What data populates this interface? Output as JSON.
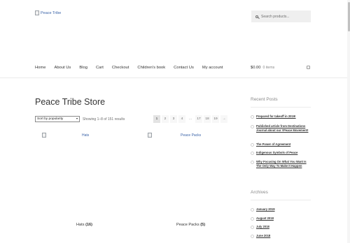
{
  "header": {
    "logo_alt": "Peace Tribe",
    "search_placeholder": "Search products..."
  },
  "nav": {
    "items": [
      "Home",
      "About Us",
      "Blog",
      "Cart",
      "Checkout",
      "Children's book",
      "Contact Us",
      "My account"
    ]
  },
  "cart": {
    "amount": "$0.00",
    "count": "0 items"
  },
  "main": {
    "title": "Peace Tribe Store",
    "sort_selected": "Sort by popularity",
    "showing": "Showing 1–8 of 151 results",
    "pages": [
      "1",
      "2",
      "3",
      "4",
      "…",
      "17",
      "18",
      "19"
    ],
    "current_page": "1",
    "products": [
      {
        "image_alt": "Hats",
        "name": "Hats",
        "count": "(16)"
      },
      {
        "image_alt": "Peace Packs",
        "name": "Peace Packs",
        "count": "(5)"
      }
    ]
  },
  "sidebar": {
    "recent_title": "Recent Posts",
    "posts": [
      "Prepared for takeoff in 2019!",
      "Published article from Destinations Journal about our #Peace Movement!",
      "The Power of Agreement",
      "Indigenous Symbols of Peace",
      "Why Focusing On What You Want Is The Only Way To Make It Happen"
    ],
    "archives_title": "Archives",
    "archives": [
      "January 2019",
      "August 2018",
      "July 2018",
      "June 2018"
    ]
  },
  "colors": {
    "link": "#3b64a8",
    "text": "#333333",
    "muted": "#8a8a8a",
    "rule": "#ebebeb"
  }
}
